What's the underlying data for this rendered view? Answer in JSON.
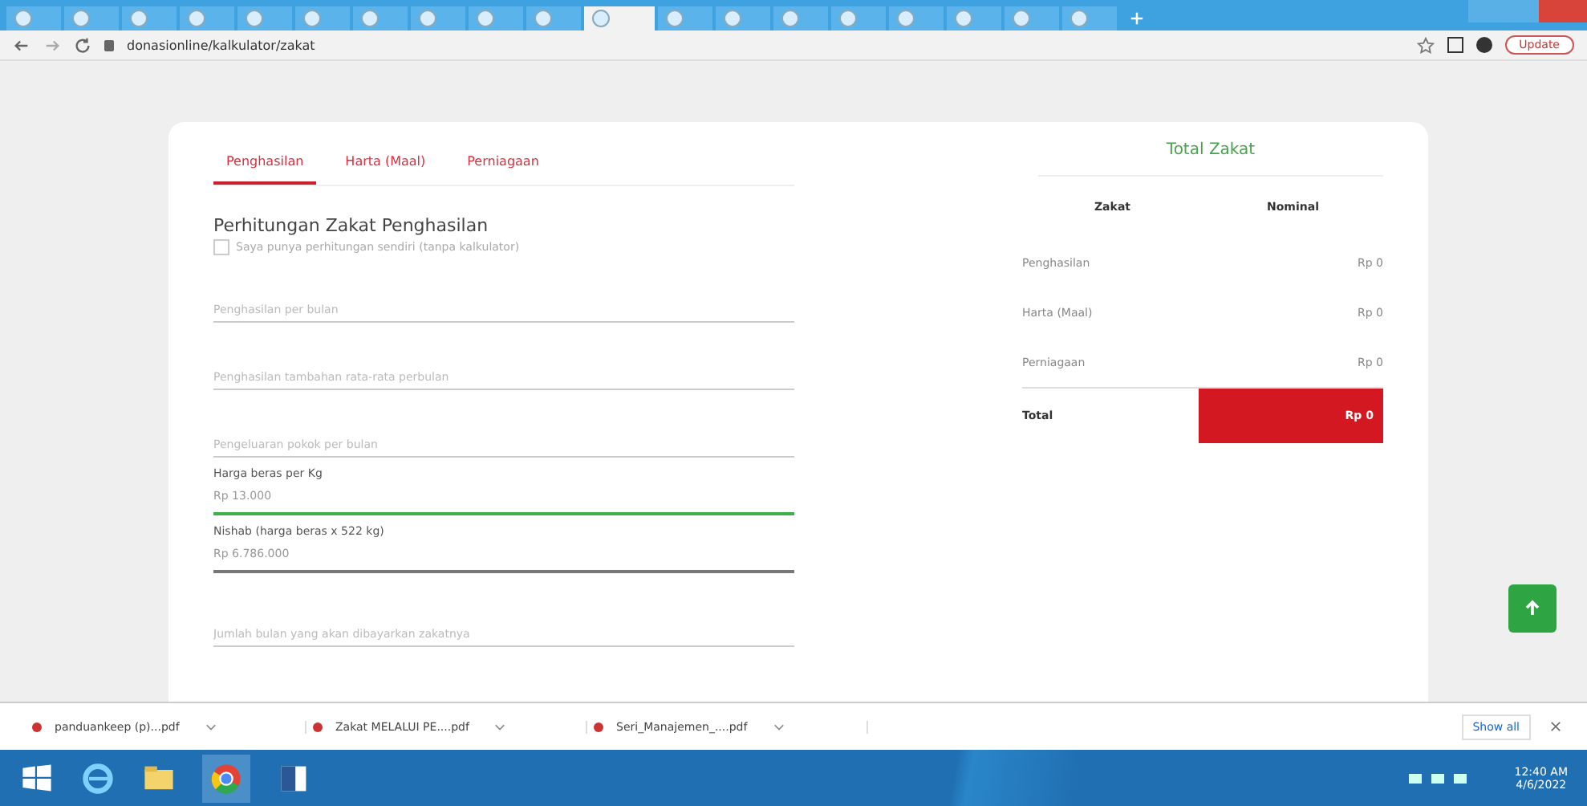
{
  "browser_tabs": [
    {
      "selected": false
    },
    {
      "selected": false
    },
    {
      "selected": false
    },
    {
      "selected": false
    },
    {
      "selected": false
    },
    {
      "selected": false
    },
    {
      "selected": false
    },
    {
      "selected": false
    },
    {
      "selected": false
    },
    {
      "selected": false
    },
    {
      "selected": true
    },
    {
      "selected": false
    },
    {
      "selected": false
    },
    {
      "selected": false
    },
    {
      "selected": false
    },
    {
      "selected": false
    },
    {
      "selected": false
    },
    {
      "selected": false
    },
    {
      "selected": false
    }
  ],
  "address_bar": {
    "url": "donasionline/kalkulator/zakat",
    "update_button": "Update"
  },
  "calculator": {
    "tabs": [
      {
        "label": "Penghasilan",
        "selected": true
      },
      {
        "label": "Harta (Maal)",
        "selected": false
      },
      {
        "label": "Perniagaan",
        "selected": false
      }
    ],
    "title": "Perhitungan Zakat Penghasilan",
    "own_calculation": {
      "label": "Saya punya perhitungan sendiri (tanpa kalkulator)",
      "checked": false
    },
    "fields": [
      {
        "placeholder": "Penghasilan per bulan"
      },
      {
        "placeholder": "Penghasilan tambahan rata-rata perbulan"
      },
      {
        "placeholder": "Pengeluaran pokok per bulan"
      },
      {
        "label": "Harga beras per Kg",
        "value": "Rp 13.000",
        "focused": true
      },
      {
        "label": "Nishab (harga beras x 522 kg)",
        "value": "Rp 6.786.000",
        "focused": false
      },
      {
        "placeholder": "Jumlah bulan yang akan dibayarkan zakatnya"
      }
    ]
  },
  "summary": {
    "title": "Total Zakat",
    "columns": [
      "Zakat",
      "Nominal"
    ],
    "rows": [
      {
        "name": "Penghasilan",
        "amount": "Rp 0"
      },
      {
        "name": "Harta (Maal)",
        "amount": "Rp 0"
      },
      {
        "name": "Perniagaan",
        "amount": "Rp 0"
      }
    ],
    "total": {
      "name": "Total",
      "amount": "Rp 0"
    }
  },
  "downloads": {
    "items": [
      "panduankeep (p)...pdf",
      "Zakat MELALUI PE....pdf",
      "Seri_Manajemen_....pdf"
    ],
    "show_all": "Show all"
  },
  "taskbar": {
    "time": "12:40 AM",
    "date": "4/6/2022"
  }
}
